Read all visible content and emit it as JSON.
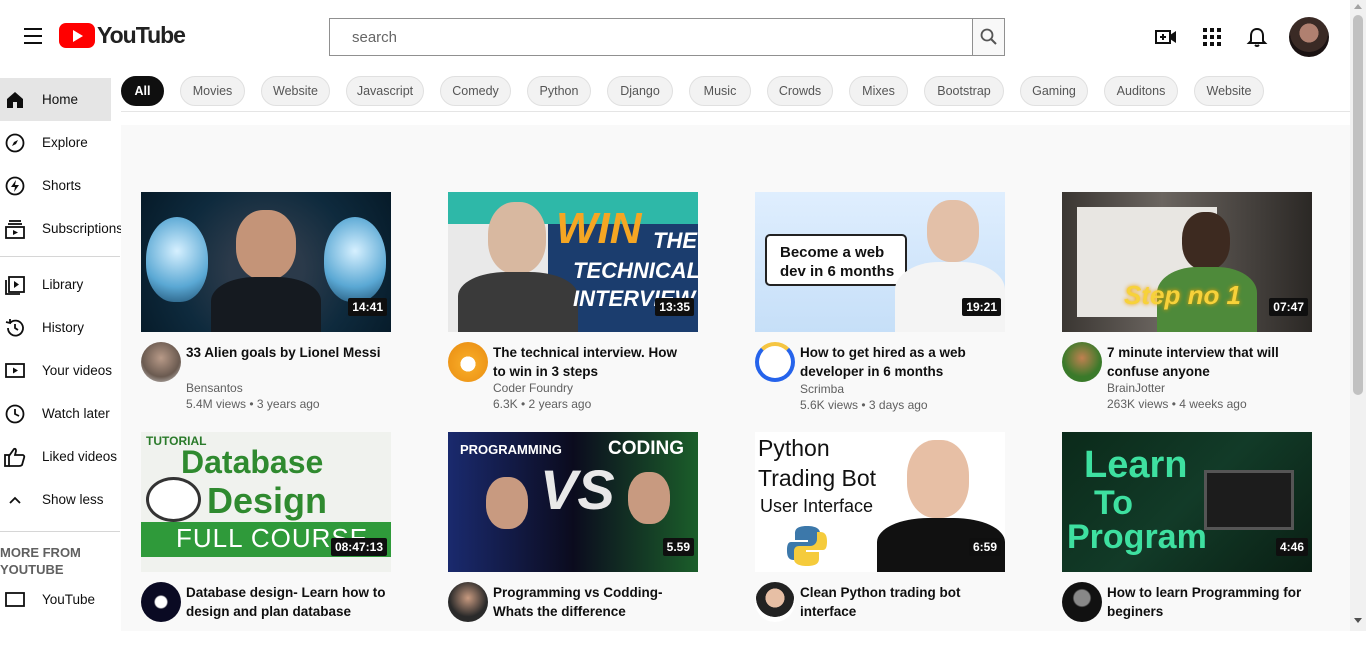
{
  "header": {
    "logo_text": "YouTube",
    "search_placeholder": "search"
  },
  "sidebar": {
    "items": [
      {
        "label": "Home"
      },
      {
        "label": "Explore"
      },
      {
        "label": "Shorts"
      },
      {
        "label": "Subscriptions"
      },
      {
        "label": "Library"
      },
      {
        "label": "History"
      },
      {
        "label": "Your videos"
      },
      {
        "label": "Watch later"
      },
      {
        "label": "Liked videos"
      },
      {
        "label": "Show less"
      },
      {
        "label": "YouTube"
      }
    ],
    "more_heading": "MORE FROM YOUTUBE"
  },
  "chips": [
    "All",
    "Movies",
    "Website",
    "Javascript",
    "Comedy",
    "Python",
    "Django",
    "Music",
    "Crowds",
    "Mixes",
    "Bootstrap",
    "Gaming",
    "Auditons",
    "Website"
  ],
  "videos": [
    {
      "title": "33 Alien goals by Lionel Messi",
      "channel": "Bensantos",
      "stats": "5.4M views • 3 years ago",
      "duration": "14:41"
    },
    {
      "title": "The technical interview. How to win in 3 steps",
      "channel": "Coder Foundry",
      "stats": "6.3K • 2 years ago",
      "duration": "13:35",
      "thumb_text": [
        "WIN",
        "THE",
        "TECHNICAL",
        "INTERVIEW"
      ]
    },
    {
      "title": "How to get hired as a web developer in 6 months",
      "channel": "Scrimba",
      "stats": "5.6K views • 3 days ago",
      "duration": "19:21",
      "thumb_text": [
        "Become a web",
        "dev in 6 months"
      ]
    },
    {
      "title": "7 minute interview that will confuse anyone",
      "channel": "BrainJotter",
      "stats": "263K views • 4 weeks ago",
      "duration": "07:47",
      "thumb_text": [
        "Step no 1"
      ]
    },
    {
      "title": "Database design- Learn how to design and plan database",
      "channel": "",
      "stats": "",
      "duration": "08:47:13",
      "thumb_text": [
        "TUTORIAL",
        "Database",
        "Design",
        "FULL COURSE"
      ]
    },
    {
      "title": "Programming vs Codding- Whats the difference",
      "channel": "",
      "stats": "",
      "duration": "5.59",
      "thumb_text": [
        "PROGRAMMING",
        "CODING",
        "VS"
      ]
    },
    {
      "title": "Clean Python trading bot interface",
      "channel": "",
      "stats": "",
      "duration": "6:59",
      "thumb_text": [
        "Python",
        "Trading Bot",
        "User Interface"
      ]
    },
    {
      "title": "How to learn Programming for beginers",
      "channel": "",
      "stats": "",
      "duration": "4:46",
      "thumb_text": [
        "Learn",
        "To",
        "Program"
      ]
    }
  ],
  "colors": {
    "brand": "#ff0000",
    "chip_active": "#0f0f0f",
    "sidebar_active": "#e5e5e5"
  }
}
